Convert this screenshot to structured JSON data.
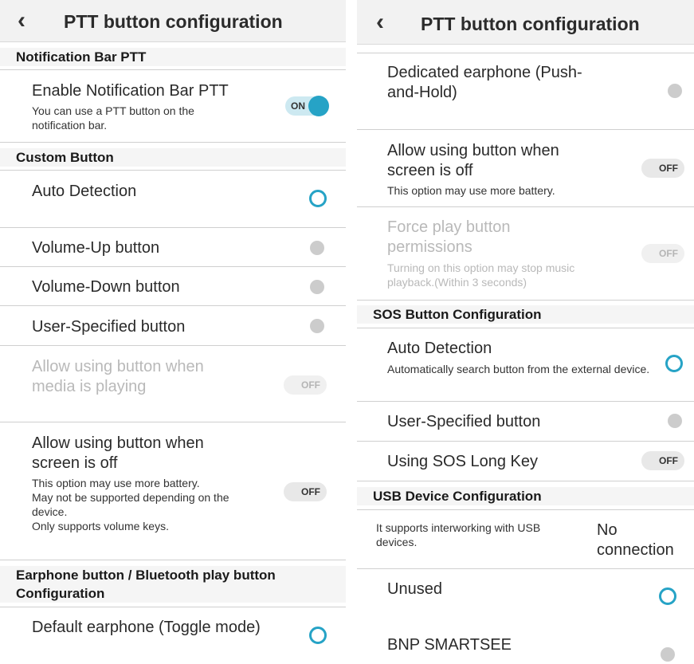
{
  "left": {
    "title": "PTT button configuration",
    "sections": {
      "notification": "Notification Bar PTT",
      "custom": "Custom Button",
      "earphone": "Earphone button / Bluetooth play button Configuration"
    },
    "enable_notification": {
      "title": "Enable Notification Bar PTT",
      "desc": "You can use a PTT button on the notification bar.",
      "toggle": "ON"
    },
    "auto_detection": "Auto Detection",
    "volume_up": "Volume-Up button",
    "volume_down": "Volume-Down button",
    "user_specified": "User-Specified button",
    "media_playing": {
      "title": "Allow using button when media is playing",
      "toggle": "OFF"
    },
    "screen_off": {
      "title": "Allow using button when screen is off",
      "desc": "This option may use more battery.\nMay not be supported depending on the device.\nOnly supports volume keys.",
      "toggle": "OFF"
    },
    "default_earphone": "Default earphone (Toggle mode)"
  },
  "right": {
    "title": "PTT button configuration",
    "dedicated_earphone": "Dedicated earphone (Push-and-Hold)",
    "screen_off": {
      "title": "Allow using button when screen is off",
      "desc": "This option may use more battery.",
      "toggle": "OFF"
    },
    "force_play": {
      "title": "Force play button permissions",
      "desc": "Turning on this option may stop music playback.(Within 3 seconds)",
      "toggle": "OFF"
    },
    "sections": {
      "sos": "SOS Button Configuration",
      "usb": "USB Device Configuration"
    },
    "sos_auto_detection": {
      "title": "Auto Detection",
      "desc": "Automatically search button from the external device."
    },
    "sos_user_specified": "User-Specified button",
    "sos_long_key": {
      "title": "Using SOS Long Key",
      "toggle": "OFF"
    },
    "usb_info": {
      "desc": "It supports interworking with USB devices.",
      "status": "No connection"
    },
    "unused": "Unused",
    "bnp_smartsee": "BNP SMARTSEE"
  },
  "colors": {
    "accent": "#26a3c6",
    "radio_off": "#cccccc",
    "toggle_off": "#e8e8e8",
    "disabled_text": "#b9b9b9"
  },
  "icons": {
    "back": "back-arrow-icon"
  }
}
